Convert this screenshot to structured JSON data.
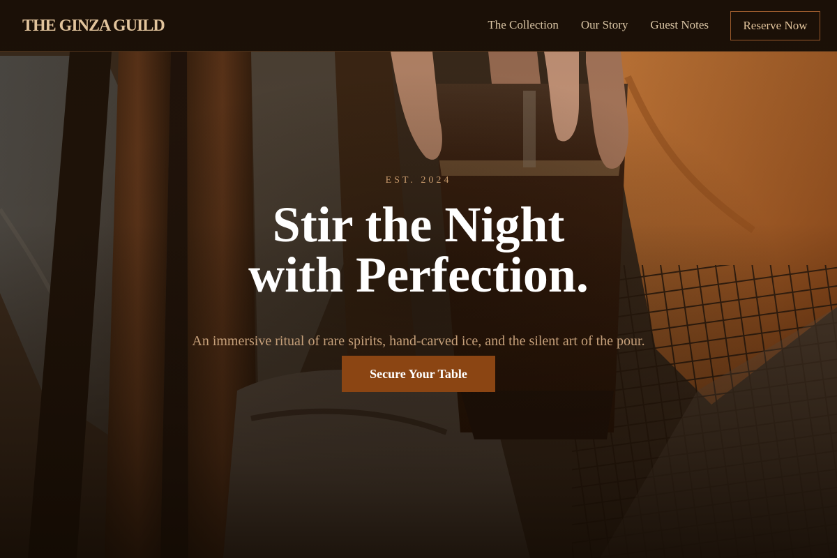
{
  "brand": {
    "name": "THE GINZA GUILD"
  },
  "nav": {
    "links": [
      "The Collection",
      "Our Story",
      "Guest Notes"
    ],
    "reserve_label": "Reserve Now"
  },
  "hero": {
    "eyebrow": "EST. 2024",
    "headline_line1": "Stir the Night",
    "headline_line2": "with Perfection.",
    "subtitle": "An immersive ritual of rare spirits, hand-carved ice, and the silent art of the pour.",
    "cta_label": "Secure Your Table",
    "background_image": "photo of hands holding a pint of amber beer at a wooden bar (sepia tinted)"
  },
  "colors": {
    "accent": "#8b4513",
    "brand_text": "#e2c49c",
    "nav_text": "#d9c4a4",
    "eyebrow": "#c89a6c",
    "subtitle": "#c6a07a",
    "headline": "#ffffff",
    "nav_background": "#180e05"
  }
}
